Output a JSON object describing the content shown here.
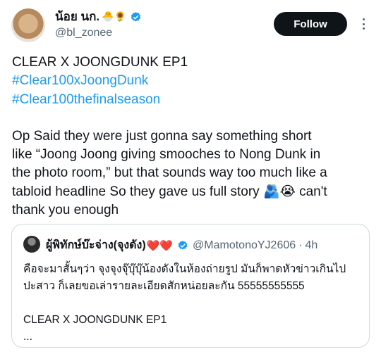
{
  "author": {
    "display_name": "น้อย นก.",
    "name_emojis": "🐣🌻",
    "handle": "@bl_zonee",
    "verified_icon": "verified-badge-icon",
    "verified_color": "#1d9bf0"
  },
  "follow_label": "Follow",
  "tweet": {
    "lines": [
      "CLEAR X JOONGDUNK EP1",
      "#Clear100xJoongDunk",
      "#Clear100thefinalseason",
      "",
      "Op Said they were just gonna say something short",
      "like “Joong Joong giving smooches to Nong Dunk in",
      "the photo room,” but that sounds way too much like a",
      "tabloid headline So they gave us full story 🫂😭 can't",
      "thank you enough"
    ],
    "hashtag_color": "#1d9bf0"
  },
  "quote": {
    "display_name": "ผู้พิทักษ์บ๊ะจ่าง(จุงดัง)",
    "name_emojis": "❤️❤️",
    "handle": "@MamotonoYJ2606",
    "separator": "·",
    "time": "4h",
    "lines": [
      "คือจะมาสั้นๆว่า จุงจุงจุ๊บุ๊บุ๊น้องดังในห้องถ่ายรูป มันก็พาดหัวข่าวเกินไป",
      "ปะสาว ก็เลยขอเล่ารายละเอียดสักหน่อยละกัน 55555555555",
      "",
      "CLEAR X JOONGDUNK EP1",
      "..."
    ]
  }
}
